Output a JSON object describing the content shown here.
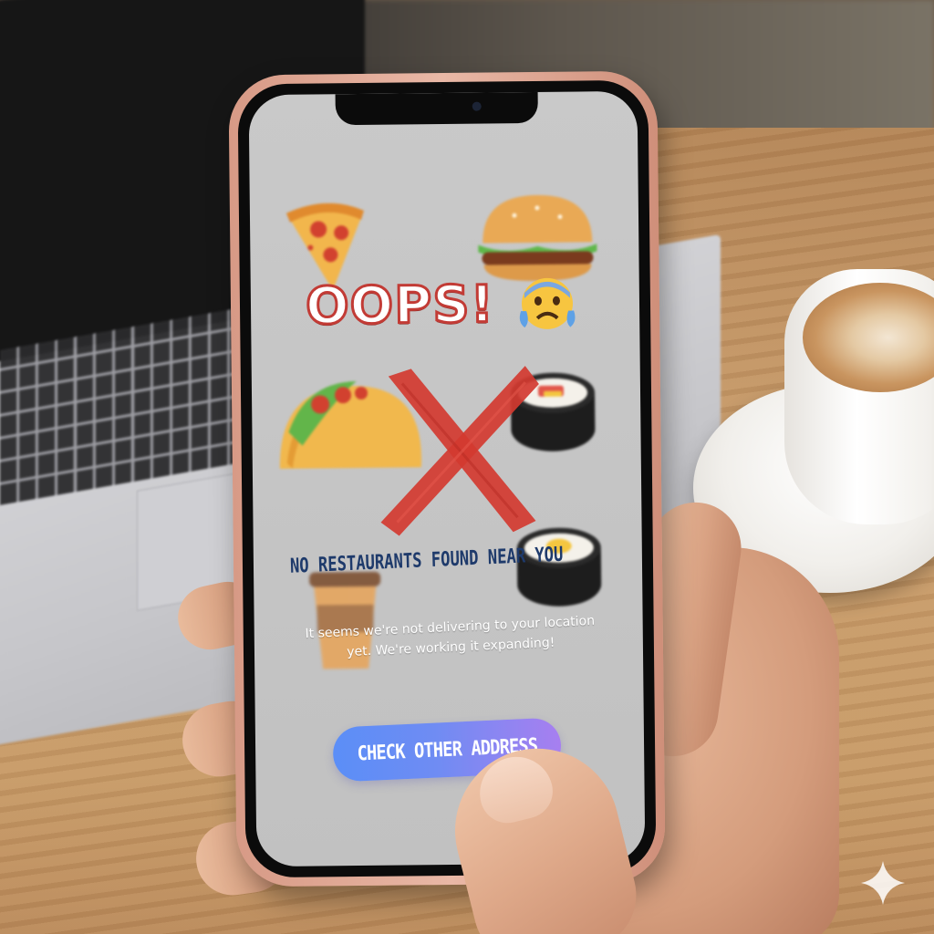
{
  "screen": {
    "title": "OOPS!",
    "headline": "NO RESTAURANTS FOUND NEAR YOU",
    "description_line1": "It seems we're not delivering to your location",
    "description_line2": "yet. We're working it expanding!",
    "cta_label": "CHECK OTHER ADDRESS"
  },
  "icons": {
    "title_emoji": "anxious-face-icon",
    "cross": "x-mark-icon",
    "foods": [
      "pizza-icon",
      "burger-icon",
      "taco-icon",
      "sushi-icon",
      "sushi-icon",
      "coffee-cup-icon"
    ]
  },
  "colors": {
    "title_fill": "#ffffff",
    "title_outline": "#c23b35",
    "headline": "#1e3a6b",
    "cross": "#d23a30",
    "cta_gradient_start": "#5b8ef7",
    "cta_gradient_end": "#a77ff0",
    "screen_background": "#c4c4c4",
    "phone_frame": "#e0a894"
  }
}
